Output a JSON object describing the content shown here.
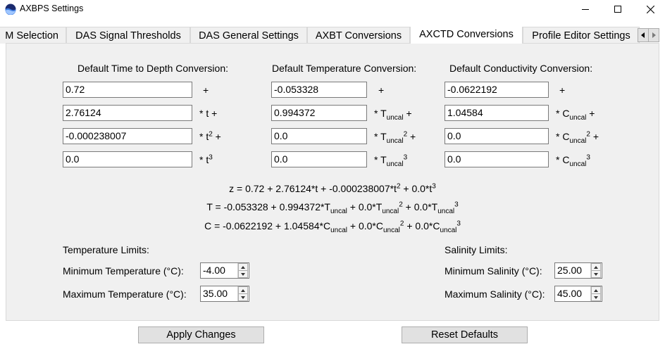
{
  "window": {
    "title": "AXBPS Settings"
  },
  "tabs": [
    "M Selection",
    "DAS Signal Thresholds",
    "DAS General Settings",
    "AXBT Conversions",
    "AXCTD Conversions",
    "Profile Editor Settings"
  ],
  "active_tab": "AXCTD Conversions",
  "depth": {
    "header": "Default Time to Depth Conversion:",
    "values": [
      "0.72",
      "2.76124",
      "-0.000238007",
      "0.0"
    ],
    "suffixes": {
      "c0": "+",
      "c1": "* t +",
      "c2a": "* t",
      "c2sup": "2",
      "c2b": " +",
      "c3a": "* t",
      "c3sup": "3"
    }
  },
  "temperature": {
    "header": "Default Temperature Conversion:",
    "values": [
      "-0.053328",
      "0.994372",
      "0.0",
      "0.0"
    ],
    "var": "T",
    "sub": "uncal"
  },
  "conductivity": {
    "header": "Default Conductivity Conversion:",
    "values": [
      "-0.0622192",
      "1.04584",
      "0.0",
      "0.0"
    ],
    "var": "C",
    "sub": "uncal"
  },
  "equations": {
    "z": {
      "a": "z = 0.72 + 2.76124*t + -0.000238007*t",
      "b": " + 0.0*t"
    },
    "T": {
      "a": "T = -0.053328 + 0.994372*T",
      "b": " + 0.0*T",
      "c": " + 0.0*T"
    },
    "C": {
      "a": "C = -0.0622192 + 1.04584*C",
      "b": " + 0.0*C",
      "c": " + 0.0*C"
    }
  },
  "temp_limits": {
    "title": "Temperature Limits:",
    "min_label": "Minimum Temperature (°C):",
    "min_value": "-4.00",
    "max_label": "Maximum Temperature (°C):",
    "max_value": "35.00"
  },
  "sal_limits": {
    "title": "Salinity Limits:",
    "min_label": "Minimum Salinity (°C):",
    "min_value": "25.00",
    "max_label": "Maximum Salinity (°C):",
    "max_value": "45.00"
  },
  "buttons": {
    "apply": "Apply Changes",
    "reset": "Reset Defaults"
  },
  "colors": {
    "panel": "#f0f0f0",
    "button": "#e1e1e1"
  }
}
